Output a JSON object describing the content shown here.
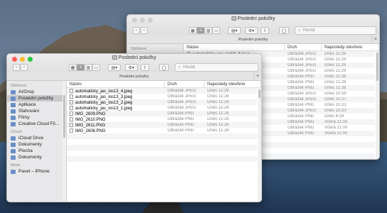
{
  "back_window": {
    "title": "Poslední položky",
    "path_title": "Poslední položky",
    "search_placeholder": "Hledat",
    "sidebar_header": "Oblíbené",
    "columns": [
      "Název",
      "Druh",
      "Naposledy otevřeno"
    ],
    "rows": [
      {
        "name": "automaticky_jas_ios13_4.jpeg",
        "kind": "Obrázek JPEG",
        "date": "Dnes 11:29"
      },
      {
        "name": "",
        "kind": "Obrázek JPEG",
        "date": "Dnes 11:29"
      },
      {
        "name": "",
        "kind": "Obrázek JPEG",
        "date": "Dnes 11:29"
      },
      {
        "name": "",
        "kind": "Obrázek JPEG",
        "date": "Dnes 11:29"
      },
      {
        "name": "",
        "kind": "Obrázek PNG",
        "date": "Dnes 11:28"
      },
      {
        "name": "",
        "kind": "Obrázek PNG",
        "date": "Dnes 11:28"
      },
      {
        "name": "",
        "kind": "Obrázek PNG",
        "date": "Dnes 11:28"
      },
      {
        "name": "...e67.jpeg",
        "kind": "Obrázek JPEG",
        "date": "Dnes 10:59"
      },
      {
        "name": "...828_n.jpg",
        "kind": "Obrázek JPEG",
        "date": "Dnes 10:27"
      },
      {
        "name": "",
        "kind": "Obrázek PNG",
        "date": "Dnes 10:21"
      },
      {
        "name": "...fa0.png",
        "kind": "Obrázek JPEG",
        "date": "Dnes 10:20"
      },
      {
        "name": "...00_o.png",
        "kind": "Obrázek PNG",
        "date": "Dnes 6:29"
      },
      {
        "name": "",
        "kind": "Obrázek PNG",
        "date": "Včera 21:03"
      },
      {
        "name": "",
        "kind": "Obrázek PNG",
        "date": "Včera 21:00"
      },
      {
        "name": "",
        "kind": "Obrázek PNG",
        "date": "Včera 21:00"
      }
    ]
  },
  "front_window": {
    "title": "Poslední položky",
    "path_title": "Poslední položky",
    "search_placeholder": "Hledat",
    "sidebar": {
      "favorites_header": "Oblíbené",
      "favorites": [
        "AirDrop",
        "Poslední položky",
        "Aplikace",
        "Stahování",
        "Filmy",
        "Creative Cloud Fil..."
      ],
      "icloud_header": "iCloud",
      "icloud": [
        "iCloud Drive",
        "Dokumenty",
        "Plocha",
        "Dokumenty"
      ],
      "locations_header": "Místa",
      "locations": [
        "Pavel – iPhone"
      ]
    },
    "columns": [
      "Název",
      "Druh",
      "Naposledy otevřeno"
    ],
    "rows": [
      {
        "name": "automaticky_jas_ios13_4.jpeg",
        "kind": "Obrázek JPEG",
        "date": "Dnes 11:29"
      },
      {
        "name": "automaticky_jas_ios13_3.jpeg",
        "kind": "Obrázek JPEG",
        "date": "Dnes 11:29"
      },
      {
        "name": "automaticky_jas_ios13_2.jpeg",
        "kind": "Obrázek JPEG",
        "date": "Dnes 11:29"
      },
      {
        "name": "automaticky_jas_ios13_1.jpeg",
        "kind": "Obrázek JPEG",
        "date": "Dnes 11:29"
      },
      {
        "name": "IMG_2609.PNG",
        "kind": "Obrázek PNG",
        "date": "Dnes 11:28"
      },
      {
        "name": "IMG_2610.PNG",
        "kind": "Obrázek PNG",
        "date": "Dnes 11:28"
      },
      {
        "name": "IMG_2611.PNG",
        "kind": "Obrázek PNG",
        "date": "Dnes 11:28"
      },
      {
        "name": "IMG_2608.PNG",
        "kind": "Obrázek PNG",
        "date": "Dnes 11:28"
      }
    ]
  },
  "colors": {
    "red": "#fe5f57",
    "yellow": "#febc2e",
    "green": "#28c840",
    "sidebar_icon": "#6a8fc7"
  }
}
